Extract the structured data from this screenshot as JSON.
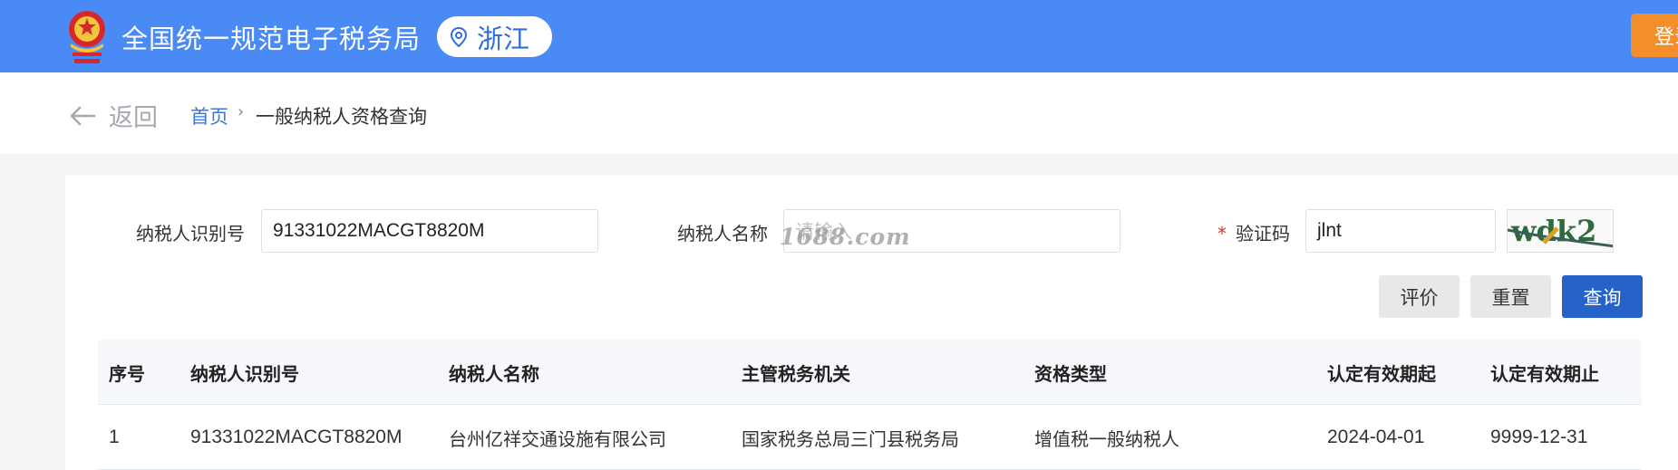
{
  "header": {
    "title": "全国统一规范电子税务局",
    "region": "浙江",
    "login_label": "登录",
    "emblem_icon": "national-emblem-icon",
    "location_icon": "location-pin-icon",
    "colors": {
      "bar": "#4a8af4",
      "login": "#f28f2b"
    }
  },
  "breadcrumb": {
    "back_label": "返回",
    "home": "首页",
    "separator": "›",
    "current": "一般纳税人资格查询"
  },
  "form": {
    "taxpayer_id_label": "纳税人识别号",
    "taxpayer_id_value": "91331022MACGT8820M",
    "taxpayer_name_label": "纳税人名称",
    "taxpayer_name_placeholder": "请输入",
    "captcha_label": "验证码",
    "required_mark": "*",
    "captcha_value": "jlnt",
    "captcha_image_text": "wdk2",
    "watermark": "1688.com"
  },
  "buttons": {
    "evaluate": "评价",
    "reset": "重置",
    "query": "查询"
  },
  "table": {
    "headers": [
      "序号",
      "纳税人识别号",
      "纳税人名称",
      "主管税务机关",
      "资格类型",
      "认定有效期起",
      "认定有效期止"
    ],
    "rows": [
      [
        "1",
        "91331022MACGT8820M",
        "台州亿祥交通设施有限公司",
        "国家税务总局三门县税务局",
        "增值税一般纳税人",
        "2024-04-01",
        "9999-12-31"
      ]
    ]
  }
}
